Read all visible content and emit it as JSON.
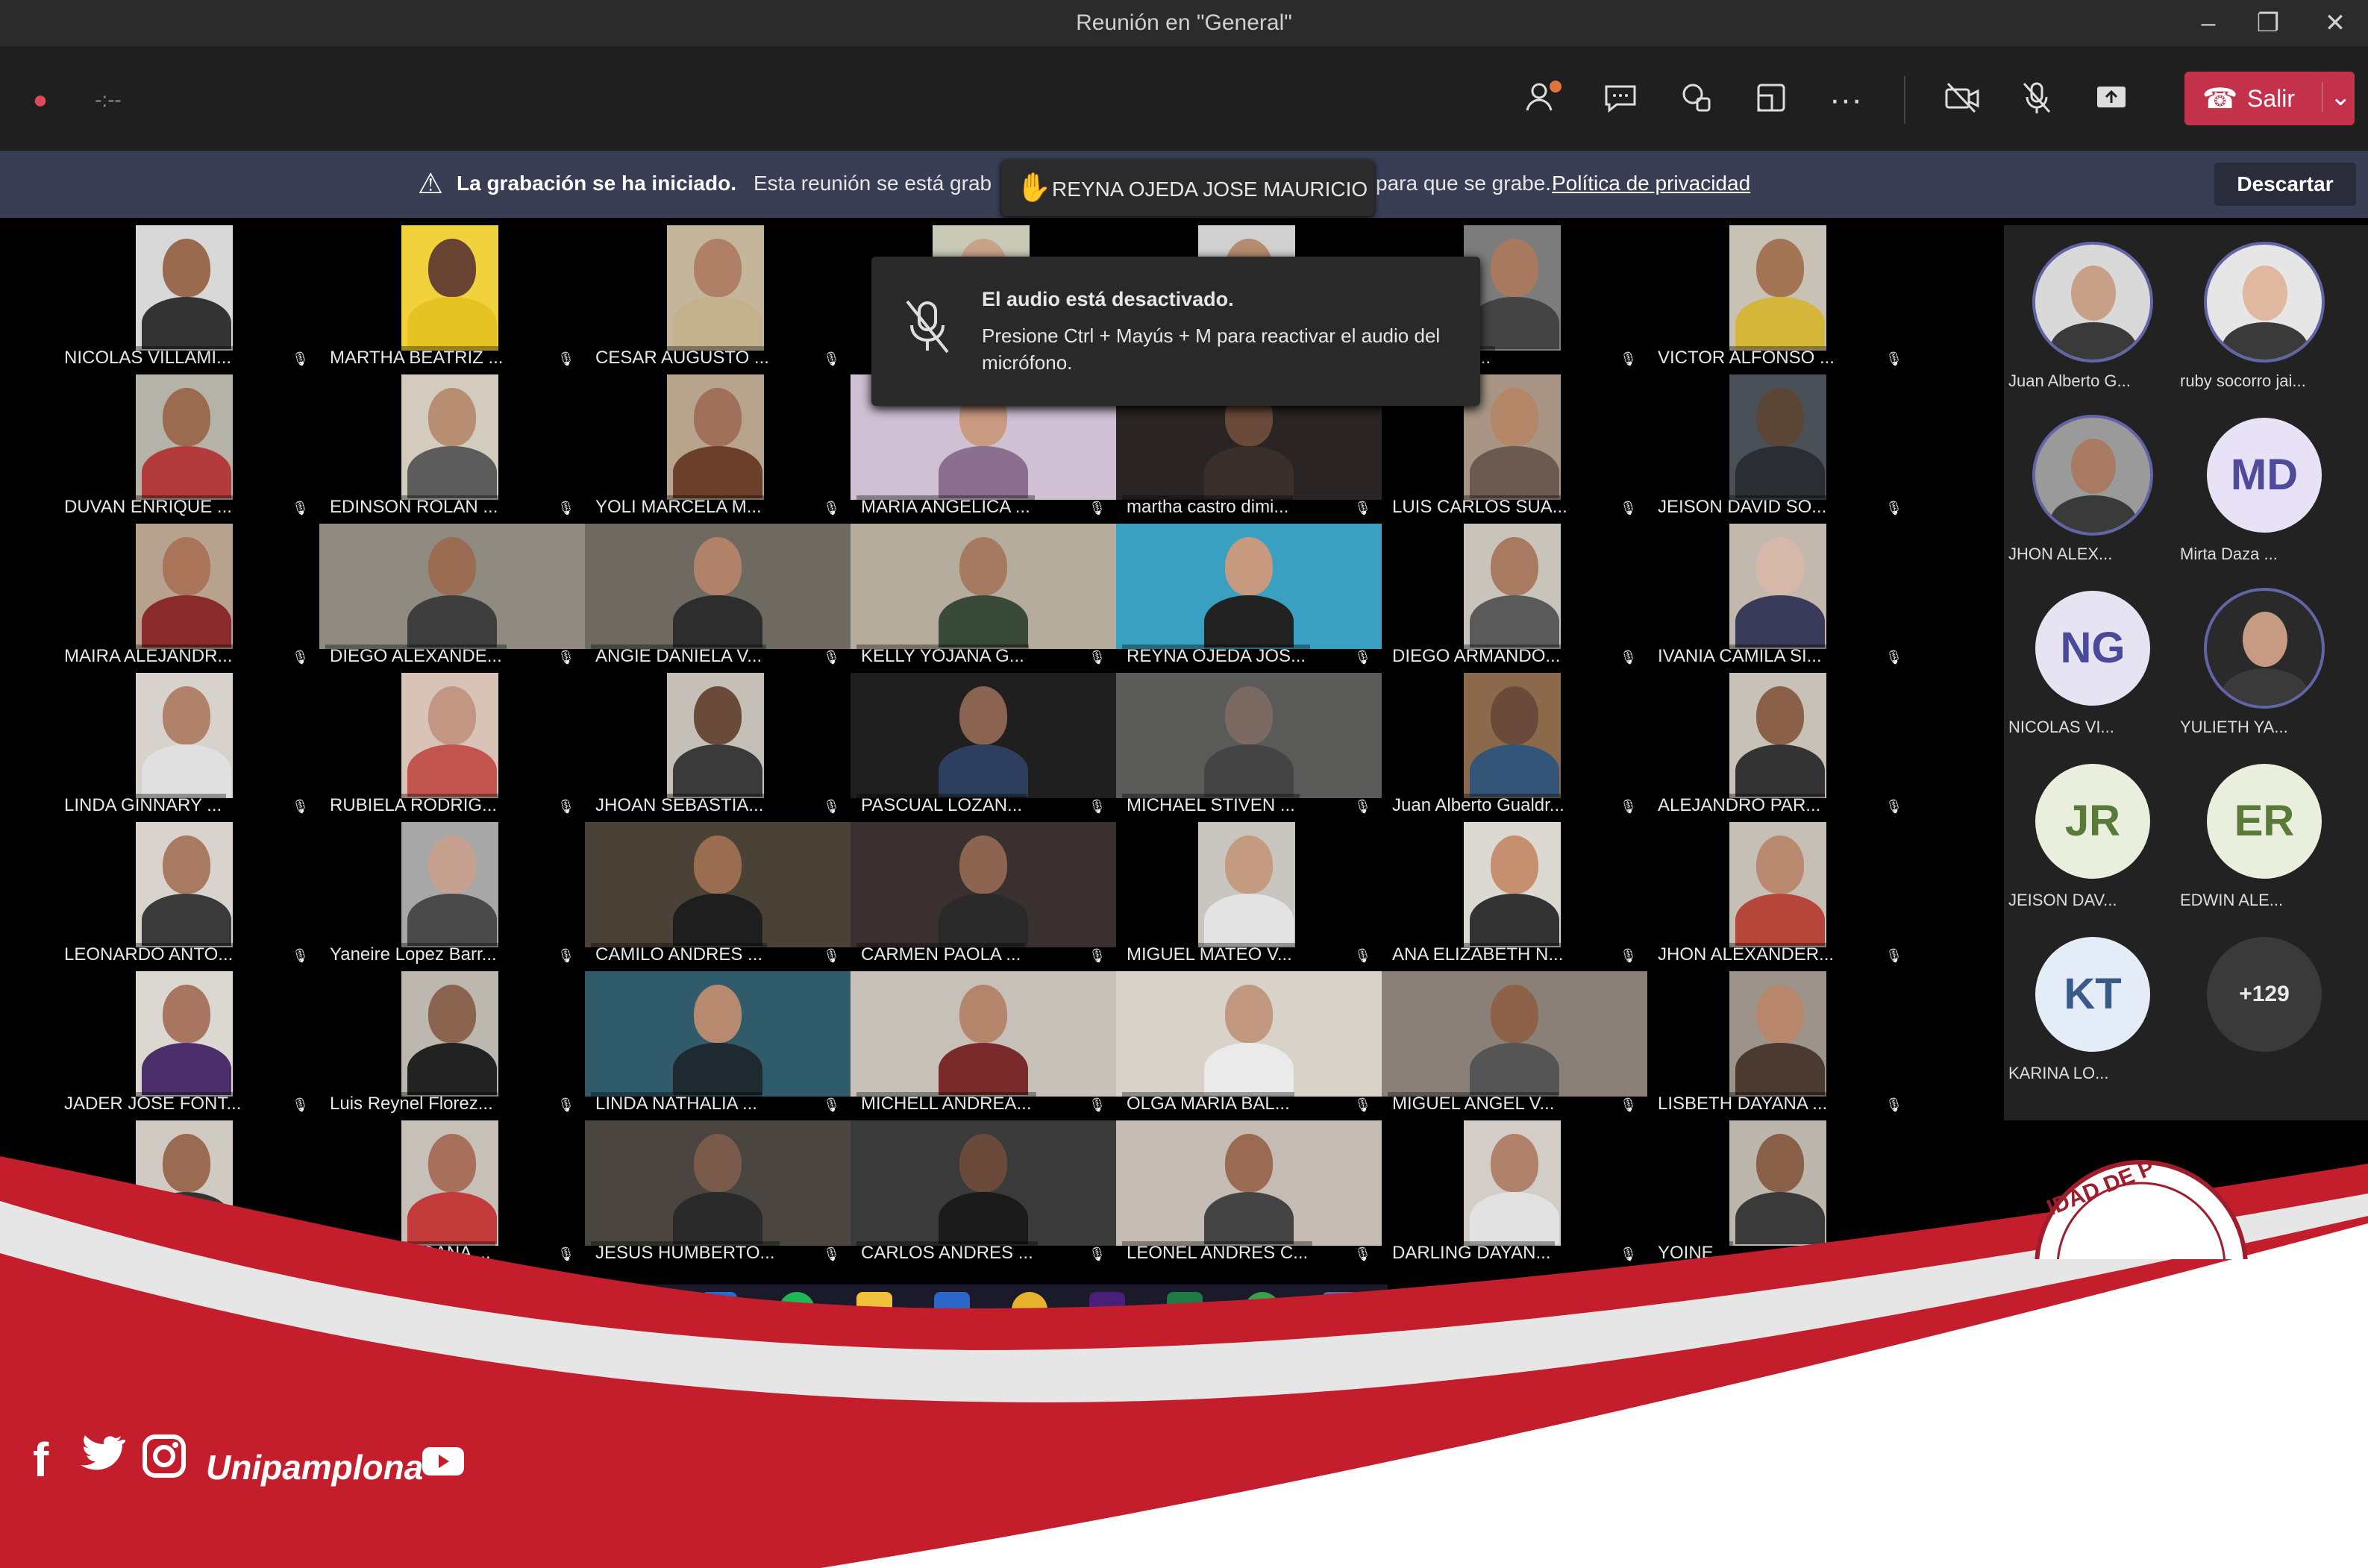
{
  "window": {
    "title": "Reunión en \"General\"",
    "min": "–",
    "max": "❐",
    "close": "✕"
  },
  "toolbar": {
    "record_dot": "●",
    "timer": "-:--",
    "leave_label": "Salir",
    "leave_caret": "⌄",
    "badge_count": "",
    "icons": [
      "participants-icon",
      "chat-icon",
      "reactions-icon",
      "rooms-icon",
      "more-icon",
      "camera-off-icon",
      "mic-off-icon",
      "share-icon"
    ]
  },
  "banner": {
    "bold": "La grabación se ha iniciado.",
    "text_a": "Esta reunión se está grab",
    "text_b": "para que se grabe.",
    "link": "Política de privacidad",
    "dismiss": "Descartar"
  },
  "raised_hand": {
    "name": "REYNA OJEDA JOSE MAURICIO"
  },
  "toast": {
    "title": "El audio está desactivado.",
    "body": "Presione Ctrl + Mayús + M para reactivar el audio del micrófono."
  },
  "tiles": [
    {
      "name": "NICOLAS VILLAMI...",
      "bg": "#d8d8d8",
      "skin": "#9a6a4f",
      "shirt": "#333"
    },
    {
      "name": "MARTHA BEATRIZ ...",
      "bg": "#f1d23c",
      "skin": "#6a4433",
      "shirt": "#e5c322"
    },
    {
      "name": "CESAR AUGUSTO ...",
      "bg": "#c4b59b",
      "skin": "#b08066",
      "shirt": "#c3b18c"
    },
    {
      "name": "",
      "bg": "#c9c9b8",
      "skin": "#c9a387",
      "shirt": "#777"
    },
    {
      "name": "",
      "bg": "#d0d0d0",
      "skin": "#b58c70",
      "shirt": "#555"
    },
    {
      "name": "ALEXAND...",
      "bg": "#7c7c7c",
      "skin": "#a8795e",
      "shirt": "#444"
    },
    {
      "name": "VICTOR ALFONSO ...",
      "bg": "#c7c2b5",
      "skin": "#a47554",
      "shirt": "#d4b63a"
    },
    {
      "name": "DUVAN ENRIQUE ...",
      "bg": "#b5b2a8",
      "skin": "#9b6b50",
      "shirt": "#b33b3b"
    },
    {
      "name": "EDINSON ROLAN ...",
      "bg": "#d2cbbe",
      "skin": "#b88e72",
      "shirt": "#5c5c5c"
    },
    {
      "name": "YOLI MARCELA M...",
      "bg": "#b8a48c",
      "skin": "#a0705a",
      "shirt": "#6b3f2a"
    },
    {
      "name": "MARIA ANGELICA ...",
      "bg": "#cfc0d4",
      "skin": "#c89a80",
      "shirt": "#8a6f8f"
    },
    {
      "name": "martha castro dimi...",
      "bg": "#2b2424",
      "skin": "#6a4a3a",
      "shirt": "#3a2f2a"
    },
    {
      "name": "LUIS CARLOS SUA...",
      "bg": "#a89585",
      "skin": "#b48668",
      "shirt": "#6a5a50"
    },
    {
      "name": "JEISON DAVID SO...",
      "bg": "#4a5058",
      "skin": "#5b4636",
      "shirt": "#2a2e33"
    },
    {
      "name": "MAIRA ALEJANDR...",
      "bg": "#b7a18f",
      "skin": "#a97458",
      "shirt": "#8a2a2a"
    },
    {
      "name": "DIEGO ALEXANDE...",
      "bg": "#8f8b80",
      "skin": "#9a6c52",
      "shirt": "#3e3e3e"
    },
    {
      "name": "ANGIE DANIELA V...",
      "bg": "#6e6a62",
      "skin": "#b0826a",
      "shirt": "#2d2d2d"
    },
    {
      "name": "KELLY YOJANA G...",
      "bg": "#b6ac9e",
      "skin": "#a67a60",
      "shirt": "#3a4a3a"
    },
    {
      "name": "REYNA OJEDA JOS...",
      "bg": "#3aa0c2",
      "skin": "#c79a80",
      "shirt": "#222"
    },
    {
      "name": "DIEGO ARMANDO...",
      "bg": "#c9c4bb",
      "skin": "#a87a60",
      "shirt": "#5a5a5a"
    },
    {
      "name": "IVANIA CAMILA SI...",
      "bg": "#c2b8ad",
      "skin": "#d6b8a8",
      "shirt": "#3a3a5a"
    },
    {
      "name": "LINDA GINNARY ...",
      "bg": "#d7d3cc",
      "skin": "#b0826a",
      "shirt": "#e0e0e0"
    },
    {
      "name": "RUBIELA RODRIG...",
      "bg": "#d9c3b7",
      "skin": "#c29683",
      "shirt": "#c2564f"
    },
    {
      "name": "JHOAN SEBASTIA...",
      "bg": "#c5c0b7",
      "skin": "#6a4b3a",
      "shirt": "#3a3a3a"
    },
    {
      "name": "PASCUAL LOZAN...",
      "bg": "#1f1f1f",
      "skin": "#8a6450",
      "shirt": "#2e3e5e"
    },
    {
      "name": "MICHAEL STIVEN ...",
      "bg": "#5a5a58",
      "skin": "#7a6a62",
      "shirt": "#444"
    },
    {
      "name": "Juan Alberto Gualdr...",
      "bg": "#8a6a4a",
      "skin": "#6a4a3a",
      "shirt": "#335577"
    },
    {
      "name": "ALEJANDRO PAR...",
      "bg": "#c8c1b8",
      "skin": "#8a6048",
      "shirt": "#333"
    },
    {
      "name": "LEONARDO ANTO...",
      "bg": "#d8d4cd",
      "skin": "#a87a62",
      "shirt": "#3a3a3a"
    },
    {
      "name": "Yaneire Lopez Barr...",
      "bg": "#a7a7a7",
      "skin": "#c7a190",
      "shirt": "#4a4a4a"
    },
    {
      "name": "CAMILO ANDRES ...",
      "bg": "#4a4236",
      "skin": "#9a6c50",
      "shirt": "#1e1e1e"
    },
    {
      "name": "CARMEN PAOLA ...",
      "bg": "#3a3030",
      "skin": "#8d6450",
      "shirt": "#2a2a2a"
    },
    {
      "name": "MIGUEL MATEO V...",
      "bg": "#c9c6c0",
      "skin": "#c49a80",
      "shirt": "#e3e3e3"
    },
    {
      "name": "ANA ELIZABETH N...",
      "bg": "#dcd9d2",
      "skin": "#c69070",
      "shirt": "#333"
    },
    {
      "name": "JHON ALEXANDER...",
      "bg": "#c6bfb6",
      "skin": "#b98a70",
      "shirt": "#b7463a"
    },
    {
      "name": "JADER JOSE FONT...",
      "bg": "#dbd8d2",
      "skin": "#a87660",
      "shirt": "#4a2f6a"
    },
    {
      "name": "Luis Reynel Florez...",
      "bg": "#bcb8b0",
      "skin": "#8a644e",
      "shirt": "#222"
    },
    {
      "name": "LINDA NATHALIA ...",
      "bg": "#2f5b6a",
      "skin": "#b7896e",
      "shirt": "#1e2a30"
    },
    {
      "name": "MICHELL ANDREA...",
      "bg": "#c7c0b8",
      "skin": "#b4856a",
      "shirt": "#7a2a2a"
    },
    {
      "name": "OLGA MARIA BAL...",
      "bg": "#d8d2c8",
      "skin": "#c29880",
      "shirt": "#eaeaea"
    },
    {
      "name": "MIGUEL ANGEL V...",
      "bg": "#8a8078",
      "skin": "#8e6248",
      "shirt": "#555"
    },
    {
      "name": "LISBETH DAYANA ...",
      "bg": "#9c948a",
      "skin": "#b8866a",
      "shirt": "#4a3a30"
    },
    {
      "name": "",
      "bg": "#cfcac2",
      "skin": "#9a6a52",
      "shirt": "#333"
    },
    {
      "name": "...ANNY JHOANA ...",
      "bg": "#c7c0b8",
      "skin": "#a8705a",
      "shirt": "#c23a3a"
    },
    {
      "name": "JESUS HUMBERTO...",
      "bg": "#4a4540",
      "skin": "#7a5a4a",
      "shirt": "#2a2a2a"
    },
    {
      "name": "CARLOS ANDRES ...",
      "bg": "#3a3a3a",
      "skin": "#6a4a3a",
      "shirt": "#1a1a1a"
    },
    {
      "name": "LEONEL ANDRES C...",
      "bg": "#c4bcb3",
      "skin": "#9a6a52",
      "shirt": "#444"
    },
    {
      "name": "DARLING DAYAN...",
      "bg": "#d2cdc6",
      "skin": "#b0826a",
      "shirt": "#e2e2e2"
    },
    {
      "name": "YOINE...",
      "bg": "#bdb6ad",
      "skin": "#8a6048",
      "shirt": "#3a3a3a"
    }
  ],
  "panel": [
    {
      "label": "Juan Alberto G...",
      "initials": "",
      "photo": true,
      "skin": "#c8a088",
      "bg": "#d9d9d9"
    },
    {
      "label": "ruby socorro jai...",
      "initials": "",
      "photo": true,
      "skin": "#e0b8a0",
      "bg": "#e6e6e6"
    },
    {
      "label": "JHON ALEX...",
      "initials": "",
      "photo": true,
      "skin": "#a87a62",
      "bg": "#9a9a9a"
    },
    {
      "label": "Mirta Daza ...",
      "initials": "MD",
      "photo": false,
      "bg": "#e7e2f6",
      "fg": "#4f4a9a"
    },
    {
      "label": "NICOLAS VI...",
      "initials": "NG",
      "photo": false,
      "bg": "#e6e4f3",
      "fg": "#4a4a9a"
    },
    {
      "label": "YULIETH YA...",
      "initials": "",
      "photo": true,
      "skin": "#c79a84",
      "bg": "#2a2a2a"
    },
    {
      "label": "JEISON DAV...",
      "initials": "JR",
      "photo": false,
      "bg": "#e9efdc",
      "fg": "#5a7a3a"
    },
    {
      "label": "EDWIN ALE...",
      "initials": "ER",
      "photo": false,
      "bg": "#e9efdc",
      "fg": "#5a7a3a"
    },
    {
      "label": "KARINA LO...",
      "initials": "KT",
      "photo": false,
      "bg": "#e4ecf8",
      "fg": "#3a5a8a"
    },
    {
      "label": "",
      "initials": "+129",
      "photo": false,
      "bg": "#3a3a3a",
      "fg": "#eaeaea"
    }
  ],
  "footer": {
    "brand": "Unipamplona",
    "seal_text": "IDAD DE P",
    "icons": [
      "facebook-icon",
      "twitter-icon",
      "instagram-icon",
      "youtube-icon"
    ]
  },
  "colors": {
    "brand_red": "#c41e2d",
    "brand_light": "#e5e5e5",
    "teams_purple": "#6264a7",
    "leave_red": "#c4314b"
  }
}
